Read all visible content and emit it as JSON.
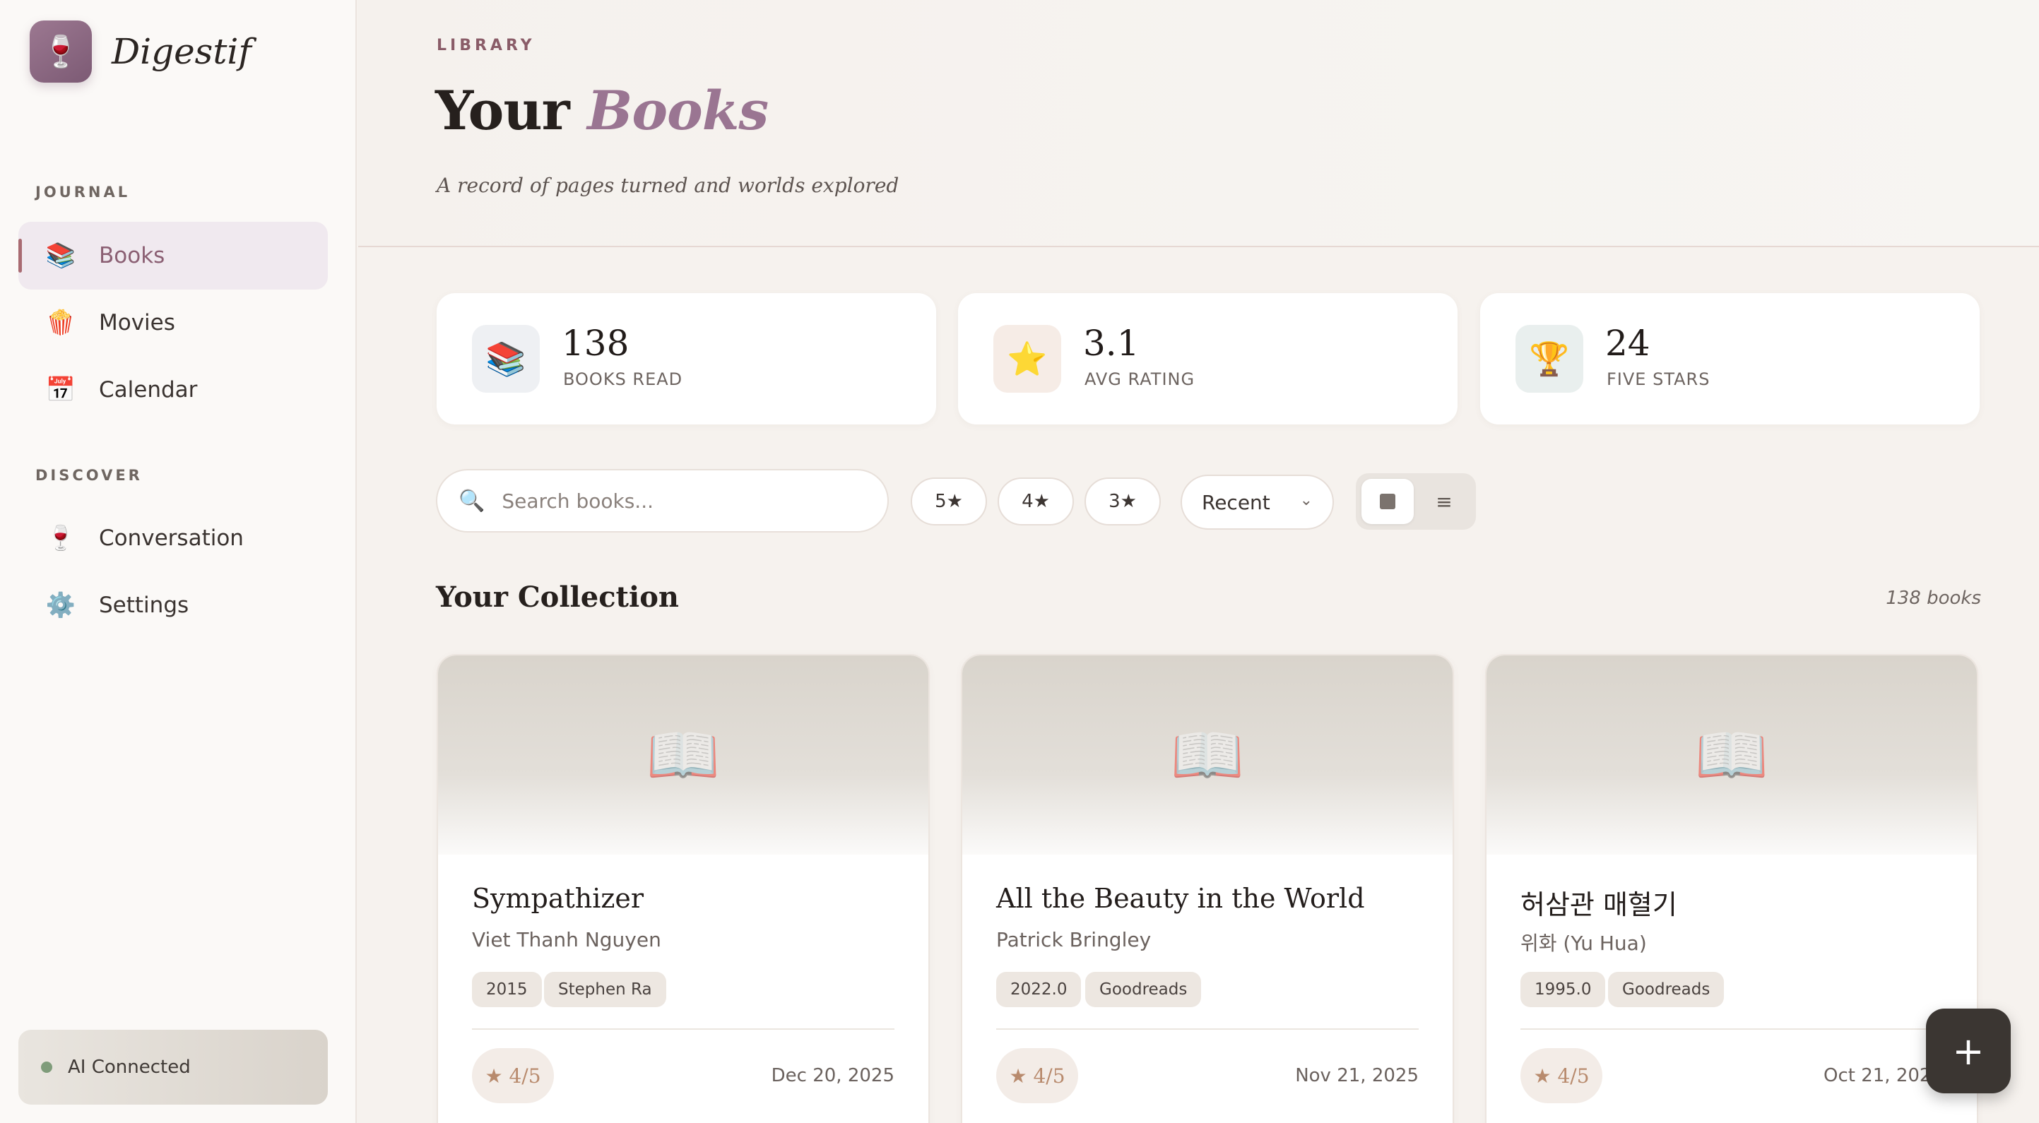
{
  "app": {
    "name": "Digestif",
    "logo_icon": "wine-glass-icon",
    "logo_glyph": "🍷"
  },
  "sidebar": {
    "sections": [
      {
        "label": "JOURNAL",
        "items": [
          {
            "label": "Books",
            "icon": "books-icon",
            "glyph": "📚",
            "active": true
          },
          {
            "label": "Movies",
            "icon": "popcorn-icon",
            "glyph": "🍿",
            "active": false
          },
          {
            "label": "Calendar",
            "icon": "calendar-icon",
            "glyph": "📅",
            "active": false
          }
        ]
      },
      {
        "label": "DISCOVER",
        "items": [
          {
            "label": "Conversation",
            "icon": "wine-glass-icon",
            "glyph": "🍷",
            "active": false
          },
          {
            "label": "Settings",
            "icon": "gear-icon",
            "glyph": "⚙️",
            "active": false
          }
        ]
      }
    ],
    "status": {
      "label": "AI Connected",
      "color": "#7f9c7a"
    }
  },
  "header": {
    "eyebrow": "LIBRARY",
    "title_plain": "Your",
    "title_accent": "Books",
    "subtitle": "A record of pages turned and worlds explored"
  },
  "stats": [
    {
      "value": "138",
      "label": "BOOKS READ",
      "icon": "books-icon",
      "glyph": "📚",
      "bg": "#eef0f3"
    },
    {
      "value": "3.1",
      "label": "AVG RATING",
      "icon": "star-icon",
      "glyph": "⭐",
      "bg": "#f6ece6"
    },
    {
      "value": "24",
      "label": "FIVE STARS",
      "icon": "trophy-icon",
      "glyph": "🏆",
      "bg": "#e9efee"
    }
  ],
  "toolbar": {
    "search_placeholder": "Search books...",
    "search_value": "",
    "filters": [
      "5★",
      "4★",
      "3★"
    ],
    "sort_value": "Recent",
    "view_list_glyph": "≡"
  },
  "collection": {
    "title": "Your Collection",
    "count": "138 books",
    "books": [
      {
        "title": "Sympathizer",
        "author": "Viet Thanh Nguyen",
        "tags": [
          "2015",
          "Stephen Ra"
        ],
        "rating": "★ 4/5",
        "date": "Dec 20, 2025"
      },
      {
        "title": "All the Beauty in the World",
        "author": "Patrick Bringley",
        "tags": [
          "2022.0",
          "Goodreads"
        ],
        "rating": "★ 4/5",
        "date": "Nov 21, 2025"
      },
      {
        "title": "허삼관 매혈기",
        "author": "위화 (Yu Hua)",
        "tags": [
          "1995.0",
          "Goodreads"
        ],
        "rating": "★ 4/5",
        "date": "Oct 21, 2025"
      }
    ],
    "cover_glyph": "📖"
  },
  "fab": {
    "label": "+"
  },
  "colors": {
    "accent": "#9a7592",
    "active_bar": "#a96b72",
    "fab": "#3b3632"
  }
}
